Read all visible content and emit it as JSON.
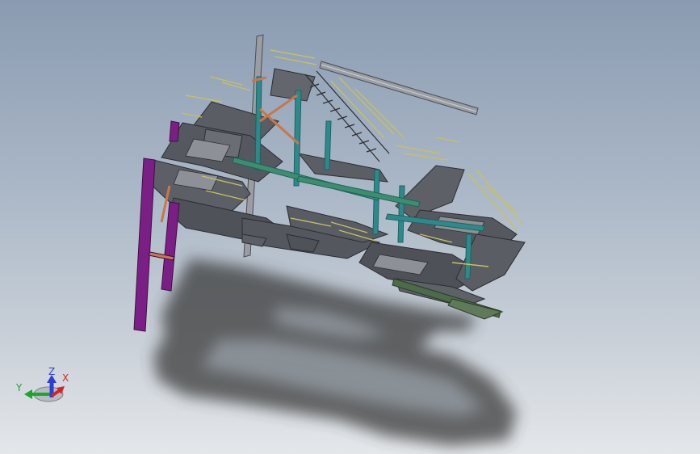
{
  "viewport": {
    "background_top": "#8a9bb1",
    "background_bottom": "#e4e7ea",
    "shadow_color": "#3a3a3a"
  },
  "model": {
    "platform_color": "#5a5d63",
    "support_column_color": "#7b1f86",
    "frame_member_color": "#2e8a8a",
    "rail_color": "#9a9da3",
    "handrail_color": "#c8c060",
    "brace_color": "#c8774a",
    "base_beam_color": "#4d6b48"
  },
  "triad": {
    "x_label": "X",
    "y_label": "Y",
    "z_label": "Z",
    "x_color": "#d42424",
    "y_color": "#1aa82b",
    "z_color": "#2b3fd6"
  }
}
